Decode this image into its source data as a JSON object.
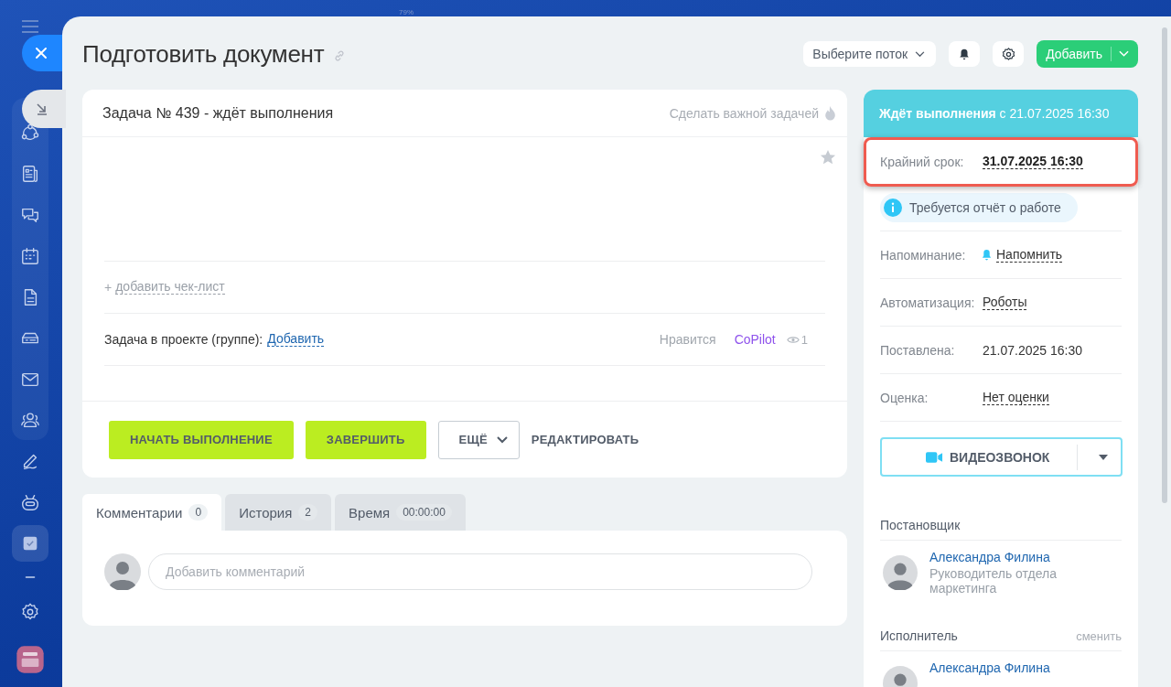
{
  "top_bar": {
    "zoom": "79%"
  },
  "sidebar": {
    "items": [
      {
        "kind": "circles",
        "selected": false,
        "grouped": true
      },
      {
        "kind": "news",
        "selected": false,
        "grouped": true
      },
      {
        "kind": "chats",
        "selected": false,
        "grouped": true
      },
      {
        "kind": "calendar",
        "selected": false,
        "grouped": true
      },
      {
        "kind": "file",
        "selected": false,
        "grouped": true
      },
      {
        "kind": "drive",
        "selected": false,
        "grouped": true
      },
      {
        "kind": "mail",
        "selected": false,
        "grouped": true
      },
      {
        "kind": "people",
        "selected": false,
        "grouped": true
      },
      {
        "kind": "pen",
        "selected": false,
        "grouped": false
      },
      {
        "kind": "robot",
        "selected": false,
        "grouped": false
      },
      {
        "kind": "tasks",
        "selected": true,
        "grouped": false
      },
      {
        "kind": "dash",
        "selected": false,
        "grouped": false
      },
      {
        "kind": "gear",
        "selected": false,
        "grouped": false
      },
      {
        "kind": "app",
        "selected": false,
        "grouped": false
      }
    ]
  },
  "header": {
    "title": "Подготовить документ",
    "flow_select": "Выберите поток",
    "add_button": "Добавить"
  },
  "task": {
    "heading": "Задача № 439 - ждёт выполнения",
    "make_important": "Сделать важной задачей",
    "favorite": false,
    "checklist_plus": "+",
    "add_checklist": "добавить чек-лист",
    "project_label": "Задача в проекте (группе):",
    "project_link": "Добавить",
    "like": "Нравится",
    "copilot": "CoPilot",
    "views": "1"
  },
  "actions": [
    {
      "label": "НАЧАТЬ ВЫПОЛНЕНИЕ",
      "kind": "primary"
    },
    {
      "label": "ЗАВЕРШИТЬ",
      "kind": "primary"
    },
    {
      "label": "ЕЩЁ",
      "kind": "dropdown"
    },
    {
      "label": "РЕДАКТИРОВАТЬ",
      "kind": "link"
    }
  ],
  "tabs": [
    {
      "label": "Комментарии",
      "count": "0",
      "selected": true
    },
    {
      "label": "История",
      "count": "2",
      "selected": false
    },
    {
      "label": "Время",
      "count": "00:00:00",
      "selected": false
    }
  ],
  "comment": {
    "placeholder": "Добавить комментарий"
  },
  "details": {
    "status": "**Ждёт выполнения** с 21.07.2025 16:30",
    "deadline_label": "Крайний срок:",
    "deadline": "31.07.2025 16:30",
    "deadline_highlighted": true,
    "report_notice": "Требуется отчёт о работе",
    "fields": [
      {
        "label": "Напоминание:",
        "value": "Напомнить",
        "kind": "reminder"
      },
      {
        "label": "Автоматизация:",
        "value": "Роботы",
        "kind": "link"
      },
      {
        "label": "Поставлена:",
        "value": "21.07.2025 16:30",
        "kind": "text"
      },
      {
        "label": "Оценка:",
        "value": "Нет оценки",
        "kind": "link"
      }
    ],
    "video_call": "ВИДЕОЗВОНОК",
    "people": [
      {
        "role": "Постановщик",
        "name": "Александра Филина",
        "position": "Руководитель отдела маркетинга"
      },
      {
        "role": "Исполнитель",
        "action": "сменить",
        "name": "Александра Филина"
      }
    ]
  }
}
